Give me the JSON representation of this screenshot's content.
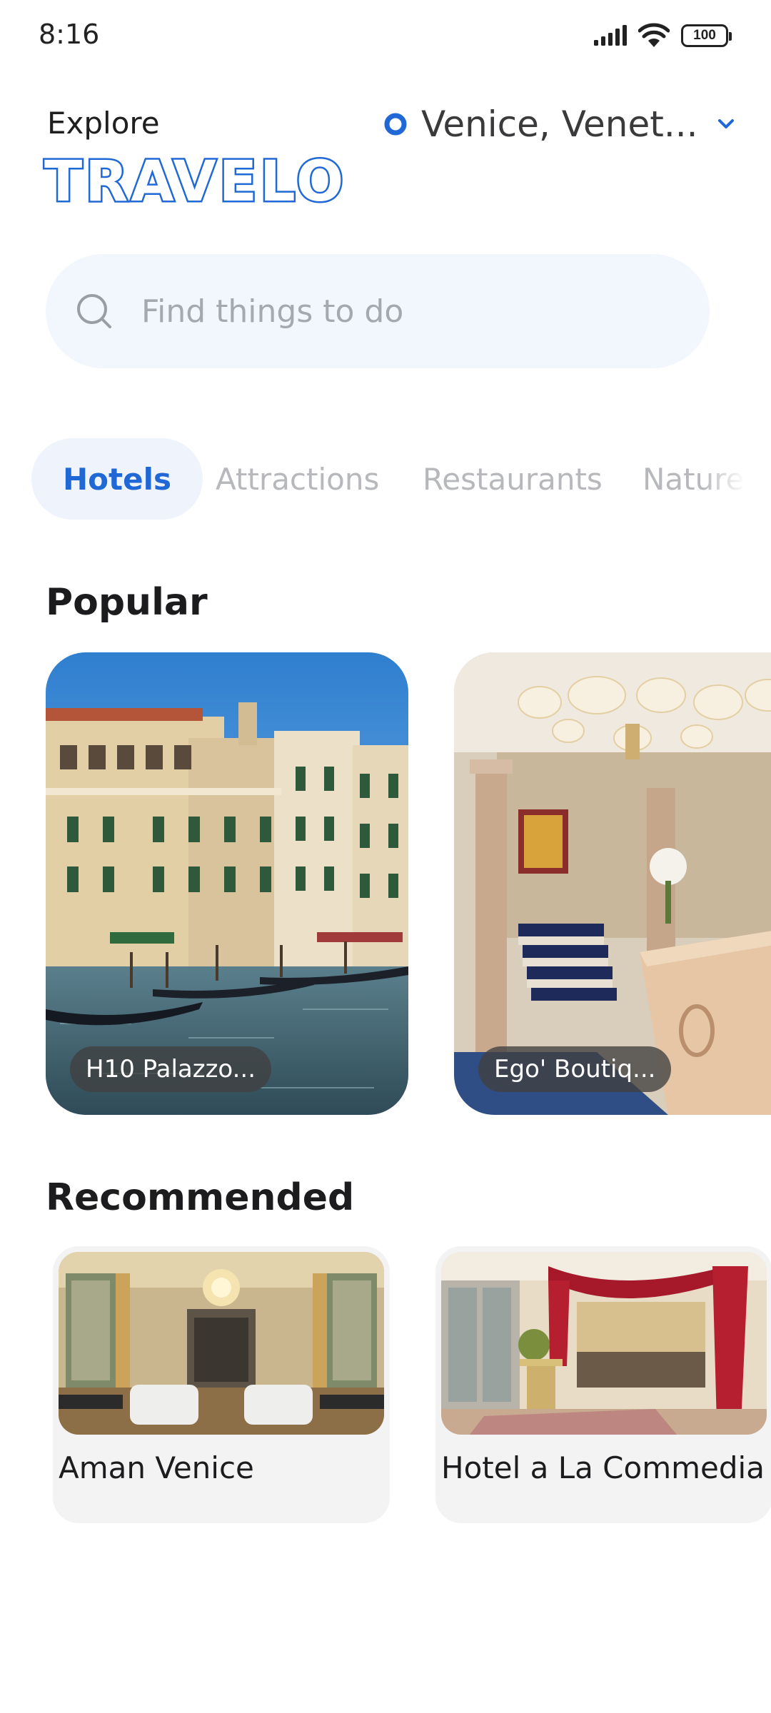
{
  "status_bar": {
    "time": "8:16",
    "battery": "100",
    "icons": [
      "signal-icon",
      "wifi-icon",
      "battery-icon"
    ]
  },
  "header": {
    "explore_label": "Explore",
    "brand": "TRAVELO",
    "location": "Venice, Venet...",
    "accent_color": "#1f68d6"
  },
  "search": {
    "placeholder": "Find things to do"
  },
  "tabs": [
    {
      "label": "Hotels",
      "active": true
    },
    {
      "label": "Attractions",
      "active": false
    },
    {
      "label": "Restaurants",
      "active": false
    },
    {
      "label": "Nature",
      "active": false
    }
  ],
  "popular": {
    "title": "Popular",
    "cards": [
      {
        "label": "H10 Palazzo..."
      },
      {
        "label": "Ego' Boutiq..."
      }
    ]
  },
  "recommended": {
    "title": "Recommended",
    "cards": [
      {
        "name": "Aman Venice"
      },
      {
        "name": "Hotel a La Commedia"
      }
    ]
  }
}
